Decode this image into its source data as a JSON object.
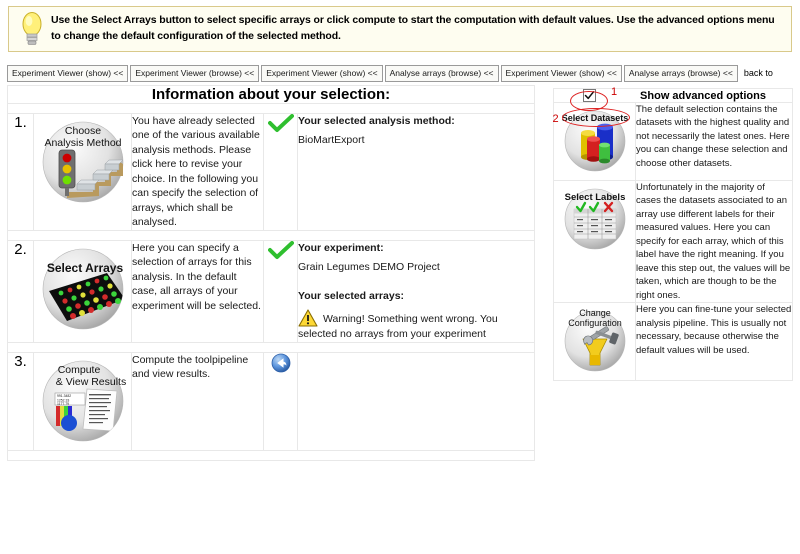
{
  "hint": {
    "icon": "lightbulb-icon",
    "text": "Use the Select Arrays button to select specific arrays or click compute to start the computation with default values. Use the advanced options menu to change the default configuration of the selected method."
  },
  "breadcrumbs": {
    "items": [
      {
        "label": "Experiment Viewer (show) <<"
      },
      {
        "label": "Experiment Viewer (browse) <<"
      },
      {
        "label": "Experiment Viewer (show) <<"
      },
      {
        "label": "Analyse arrays (browse) <<"
      },
      {
        "label": "Experiment Viewer (show) <<"
      },
      {
        "label": "Analyse arrays (browse) <<"
      }
    ],
    "trailing": "back to"
  },
  "main": {
    "title": "Information about your selection:",
    "steps": [
      {
        "number": "1.",
        "icon_name": "choose-analysis-method-icon",
        "icon_caption_line1": "Choose",
        "icon_caption_line2": "Analysis Method",
        "description": "You have already selected one of the various available analysis methods. Please click here to revise your choice. In the following you can specify the selection of arrays, which shall be analysed.",
        "status_icon": "green-check-icon",
        "info_blocks": [
          {
            "heading": "Your selected analysis method:",
            "value": "BioMartExport"
          }
        ]
      },
      {
        "number": "2.",
        "icon_name": "select-arrays-icon",
        "icon_caption_line1": "Select Arrays",
        "icon_caption_line2": "",
        "description": "Here you can specify a selection of arrays for this analysis. In the default case, all arrays of your experiment will be selected.",
        "status_icon": "green-check-icon",
        "info_blocks": [
          {
            "heading": "Your experiment:",
            "value": "Grain Legumes DEMO Project"
          },
          {
            "heading": "Your selected arrays:",
            "value": ""
          }
        ],
        "warning": {
          "icon": "warning-triangle-icon",
          "text": "Warning! Something went wrong. You selected no arrays from your experiment"
        }
      },
      {
        "number": "3.",
        "icon_name": "compute-view-results-icon",
        "icon_caption_line1": "Compute",
        "icon_caption_line2": "& View Results",
        "description": "Compute the toolpipeline and view results.",
        "status_icon": "blue-arrow-left-icon",
        "info_blocks": []
      }
    ]
  },
  "sidebar": {
    "advanced": {
      "checkbox_checked": true,
      "checkbox_icon": "checkmark-icon",
      "label": "Show advanced options",
      "annotation_number": "1"
    },
    "items": [
      {
        "icon_name": "select-datasets-icon",
        "caption_line1": "Select Datasets",
        "caption_line2": "",
        "annotation_number": "2",
        "description": "The default selection contains the datasets with the highest quality and not necessarily the latest ones. Here you can change these selection and choose other datasets."
      },
      {
        "icon_name": "select-labels-icon",
        "caption_line1": "Select Labels",
        "caption_line2": "",
        "annotation_number": "",
        "description": "Unfortunately in the majority of cases the datasets associated to an array use different labels for their measured values. Here you can specify for each array, which of this label have the right meaning. If you leave this step out, the values will be taken, which are though to be the right ones."
      },
      {
        "icon_name": "change-configuration-icon",
        "caption_line1": "Change",
        "caption_line2": "Configuration",
        "annotation_number": "",
        "description": "Here you can fine-tune your selected analysis pipeline. This is usually not necessary, because otherwise the default values will be used."
      }
    ]
  },
  "colors": {
    "banner_bg": "#fefdf0",
    "banner_border": "#d9c98a",
    "check_green": "#2fbf2f",
    "warn_yellow": "#f5c518",
    "annotation_red": "#dd2222",
    "blue_icon": "#3a78c8"
  }
}
